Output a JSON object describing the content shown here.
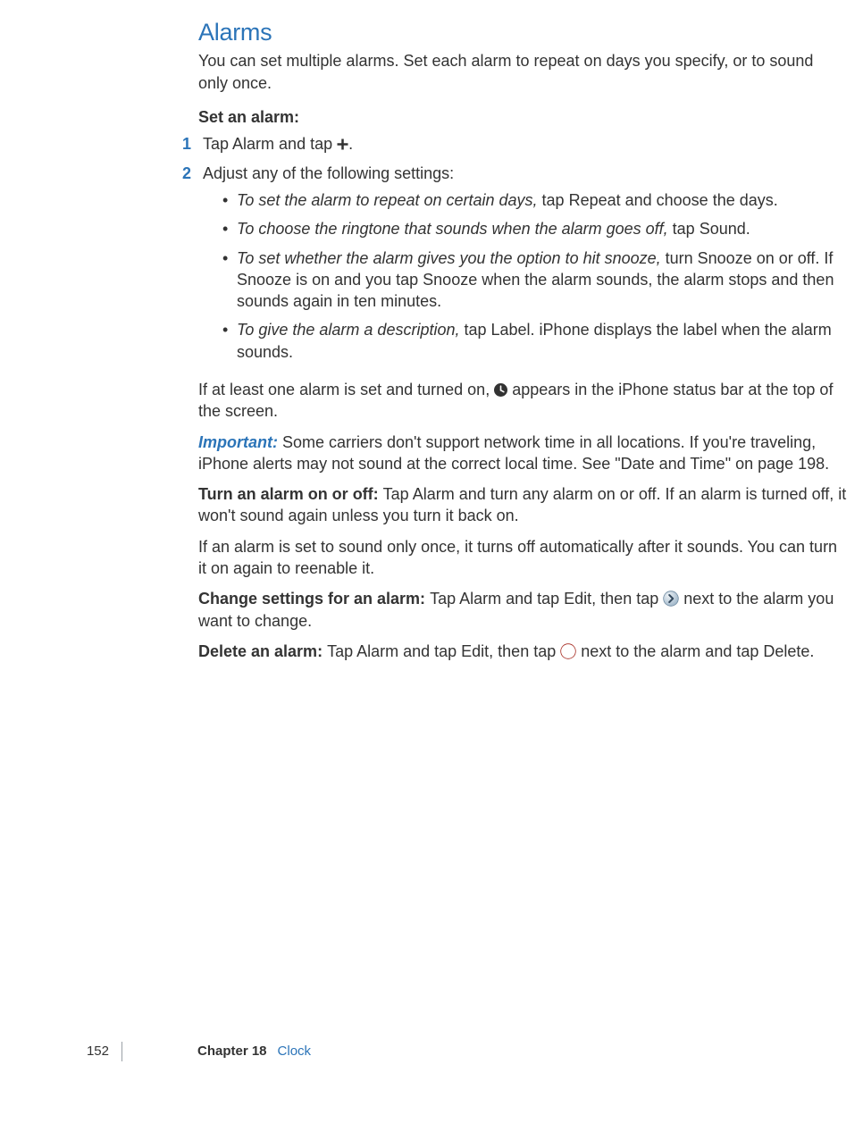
{
  "section_title": "Alarms",
  "intro": "You can set multiple alarms. Set each alarm to repeat on days you specify, or to sound only once.",
  "set_alarm_heading": "Set an alarm:",
  "step1_num": "1",
  "step1_a": "Tap Alarm and tap ",
  "step1_b": ".",
  "step2_num": "2",
  "step2_text": "Adjust any of the following settings:",
  "bullet1_em": "To set the alarm to repeat on certain days,",
  "bullet1_rest": " tap Repeat and choose the days.",
  "bullet2_em": "To choose the ringtone that sounds when the alarm goes off,",
  "bullet2_rest": " tap Sound.",
  "bullet3_em": "To set whether the alarm gives you the option to hit snooze,",
  "bullet3_rest": " turn Snooze on or off. If Snooze is on and you tap Snooze when the alarm sounds, the alarm stops and then sounds again in ten minutes.",
  "bullet4_em": "To give the alarm a description,",
  "bullet4_rest": " tap Label. iPhone displays the label when the alarm sounds.",
  "status_a": "If at least one alarm is set and turned on, ",
  "status_b": " appears in the iPhone status bar at the top of the screen.",
  "important_label": "Important:  ",
  "important_text": "Some carriers don't support network time in all locations. If you're traveling, iPhone alerts may not sound at the correct local time. See \"Date and Time\" on page 198.",
  "turn_label": "Turn an alarm on or off:  ",
  "turn_text": "Tap Alarm and turn any alarm on or off. If an alarm is turned off, it won't sound again unless you turn it back on.",
  "once_text": "If an alarm is set to sound only once, it turns off automatically after it sounds. You can turn it on again to reenable it.",
  "change_label": "Change settings for an alarm:  ",
  "change_a": "Tap Alarm and tap Edit, then tap ",
  "change_b": " next to the alarm you want to change.",
  "delete_label": "Delete an alarm:  ",
  "delete_a": "Tap Alarm and tap Edit, then tap ",
  "delete_b": " next to the alarm and tap Delete.",
  "footer": {
    "page": "152",
    "chapter_label": "Chapter 18",
    "chapter_name": "Clock"
  }
}
